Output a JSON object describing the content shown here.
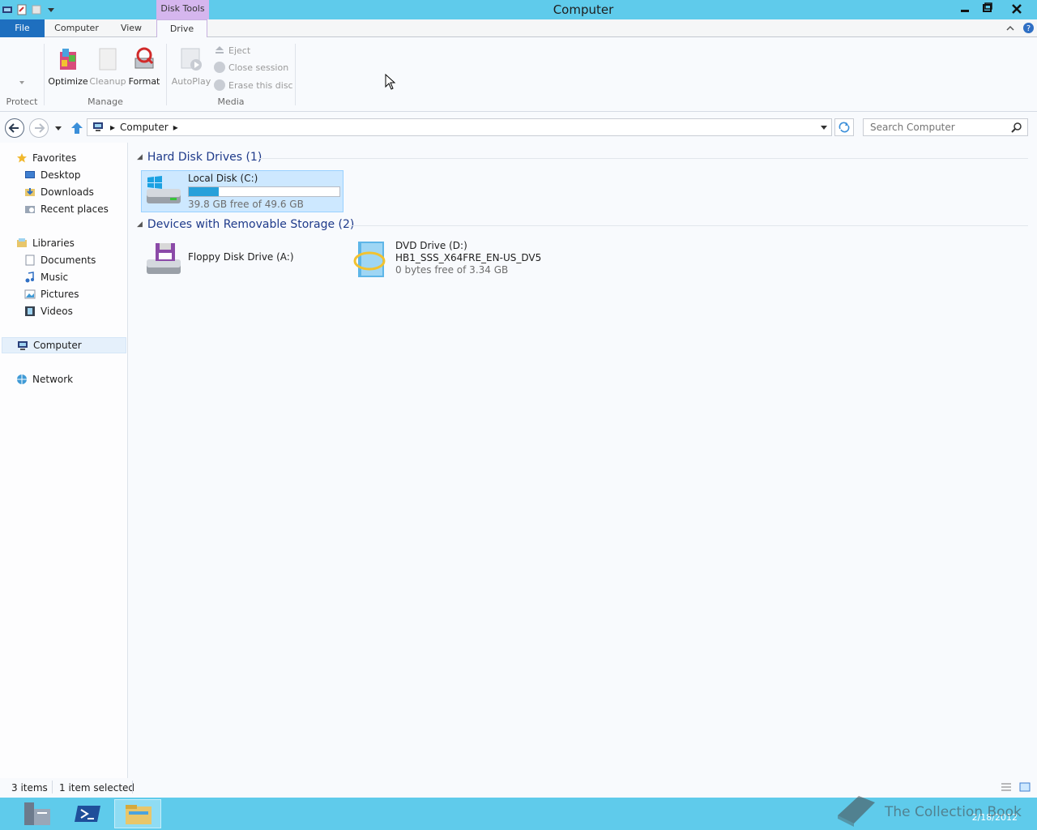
{
  "window": {
    "title": "Computer",
    "contextual_tab_group": "Disk Tools",
    "minimize": "‒",
    "restore": "❐",
    "close": "✕"
  },
  "ribbon": {
    "tabs": [
      "File",
      "Computer",
      "View",
      "Drive"
    ],
    "active_tab": "Drive",
    "groups": {
      "protect": {
        "label": "Protect"
      },
      "manage": {
        "label": "Manage",
        "buttons": [
          "Optimize",
          "Cleanup",
          "Format"
        ]
      },
      "media": {
        "label": "Media",
        "autoplay": "AutoPlay",
        "eject": "Eject",
        "close_session": "Close session",
        "erase": "Erase this disc"
      }
    }
  },
  "address": {
    "crumb": "Computer",
    "search_placeholder": "Search Computer"
  },
  "navpane": {
    "favorites": {
      "label": "Favorites",
      "items": [
        "Desktop",
        "Downloads",
        "Recent places"
      ]
    },
    "libraries": {
      "label": "Libraries",
      "items": [
        "Documents",
        "Music",
        "Pictures",
        "Videos"
      ]
    },
    "computer": "Computer",
    "network": "Network"
  },
  "content": {
    "hard_disks": {
      "header": "Hard Disk Drives (1)",
      "items": [
        {
          "name": "Local Disk (C:)",
          "free_text": "39.8 GB free of 49.6 GB",
          "used_fraction": 0.198,
          "selected": true
        }
      ]
    },
    "removable": {
      "header": "Devices with Removable Storage (2)",
      "items": [
        {
          "name": "Floppy Disk Drive (A:)"
        },
        {
          "name": "DVD Drive (D:)",
          "label": "HB1_SSS_X64FRE_EN-US_DV5",
          "free_text": "0 bytes free of 3.34 GB"
        }
      ]
    }
  },
  "status": {
    "items_count": "3 items",
    "selected": "1 item selected"
  },
  "taskbar": {
    "date": "2/18/2012",
    "watermark": "The Collection Book"
  },
  "colors": {
    "titlebar": "#5fcbeb",
    "contextual_tab": "#d5b6ee",
    "file_tab": "#1e6fbf",
    "selection": "#cde8ff",
    "progress": "#26a0da"
  }
}
